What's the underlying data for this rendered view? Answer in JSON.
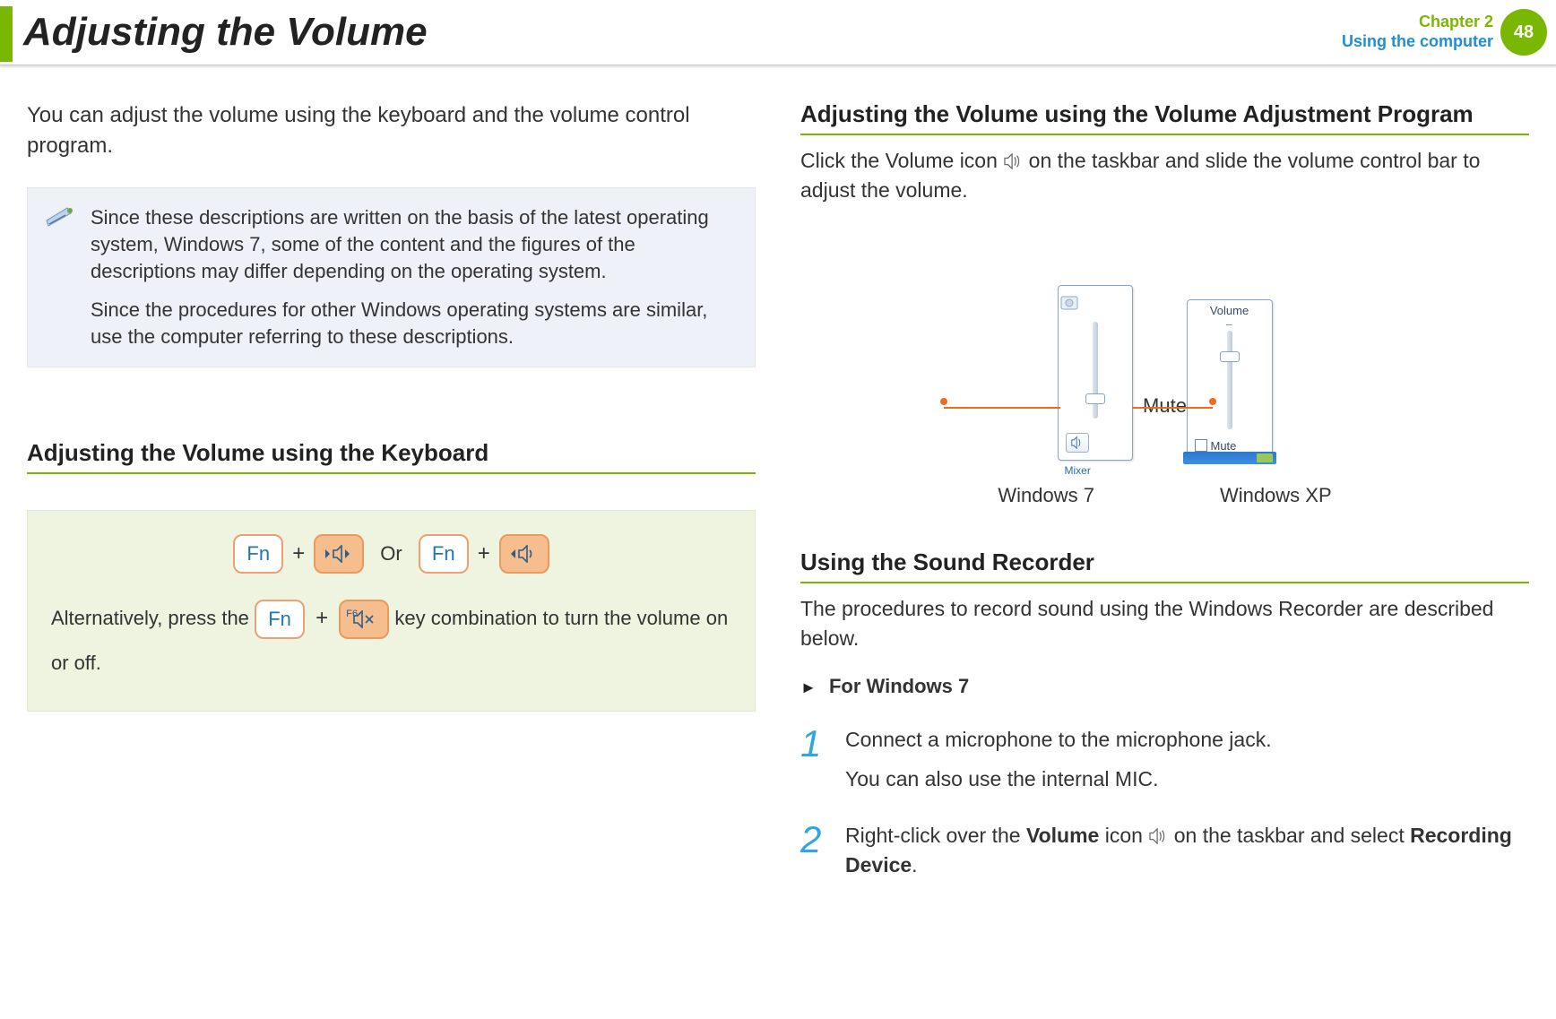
{
  "header": {
    "title": "Adjusting the Volume",
    "chapter_line": "Chapter 2",
    "chapter_sub": "Using the computer",
    "page_number": "48"
  },
  "left": {
    "intro": "You can adjust the volume using the keyboard and the volume control program.",
    "note_p1": "Since these descriptions are written on the basis of the latest operating system, Windows 7, some of the content and the figures of the descriptions may differ depending on the operating system.",
    "note_p2": "Since the procedures for other Windows operating systems are similar, use the computer referring to these descriptions.",
    "section1": "Adjusting the Volume using the Keyboard",
    "key_fn": "Fn",
    "plus": "+",
    "or": "Or",
    "alt_prefix": "Alternatively, press the ",
    "alt_suffix": " key combination to turn the volume on or off.",
    "f6": "F6"
  },
  "right": {
    "section1": "Adjusting the Volume using the Volume Adjustment Program",
    "vol_text_a": "Click the Volume icon ",
    "vol_text_b": " on the taskbar and slide the volume control bar to adjust the volume.",
    "mixer": "Mixer",
    "mute_label": "Mute",
    "vol_xp_title": "Volume",
    "mute_xp": "Mute",
    "os7": "Windows 7",
    "osxp": "Windows XP",
    "section2": "Using the Sound Recorder",
    "rec_intro": "The procedures to record sound using the Windows Recorder are described below.",
    "for_win7": "For Windows 7",
    "step1_a": "Connect a microphone to the microphone jack.",
    "step1_b": "You can also use the internal MIC.",
    "step2_a": "Right-click over the ",
    "step2_vol": "Volume",
    "step2_b": " icon ",
    "step2_c": " on the taskbar and select ",
    "step2_rec": "Recording Device",
    "step2_d": ".",
    "num1": "1",
    "num2": "2"
  }
}
